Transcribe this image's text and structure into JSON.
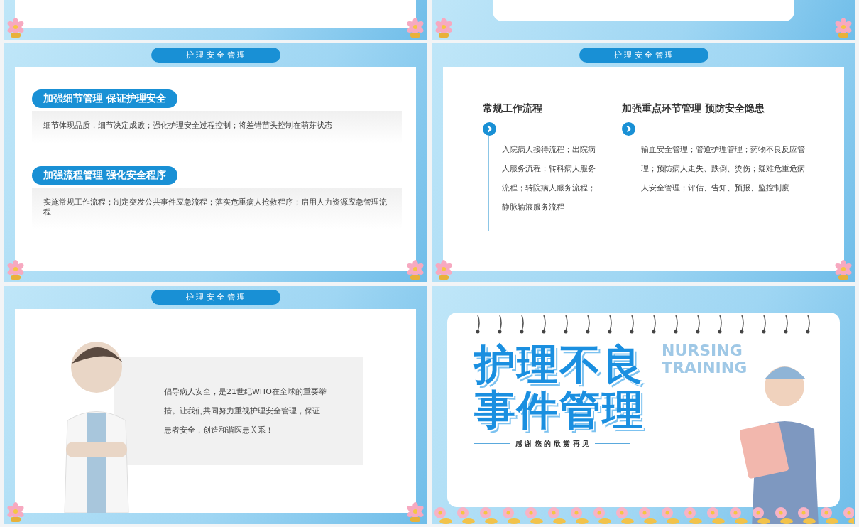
{
  "slides": [
    {
      "kind": "partial_panel"
    },
    {
      "kind": "partial_card"
    },
    {
      "kind": "sections",
      "header": "护 理 安 全 管 理",
      "sections": [
        {
          "heading": "加强细节管理 保证护理安全",
          "text": "细节体现品质，细节决定成败；强化护理安全过程控制；将差错苗头控制在萌芽状态"
        },
        {
          "heading": "加强流程管理 强化安全程序",
          "text": "实施常规工作流程；制定突发公共事件应急流程；落实危重病人抢救程序；启用人力资源应急管理流程"
        }
      ]
    },
    {
      "kind": "columns",
      "header": "护 理 安 全 管 理",
      "columns": [
        {
          "heading": "常规工作流程",
          "text": "入院病人接待流程；出院病人服务流程；转科病人服务流程；转院病人服务流程；静脉输液服务流程"
        },
        {
          "heading": "加强重点环节管理 预防安全隐患",
          "text": "输血安全管理；管道护理管理；药物不良反应管理；预防病人走失、跌倒、烫伤；疑难危重危病人安全管理；评估、告知、预报、监控制度"
        }
      ]
    },
    {
      "kind": "quote",
      "header": "护 理 安 全 管 理",
      "text": "倡导病人安全，是21世纪WHO在全球的重要举措。让我们共同努力重视护理安全管理，保证患者安全，创造和谐医患关系！"
    },
    {
      "kind": "cover",
      "title_lines": [
        "护理不良",
        "事件管理"
      ],
      "subtitle": "感 谢 您 的 欣 赏 再 见",
      "watermark_lines": [
        "NURSING",
        "TRAINING"
      ]
    }
  ]
}
